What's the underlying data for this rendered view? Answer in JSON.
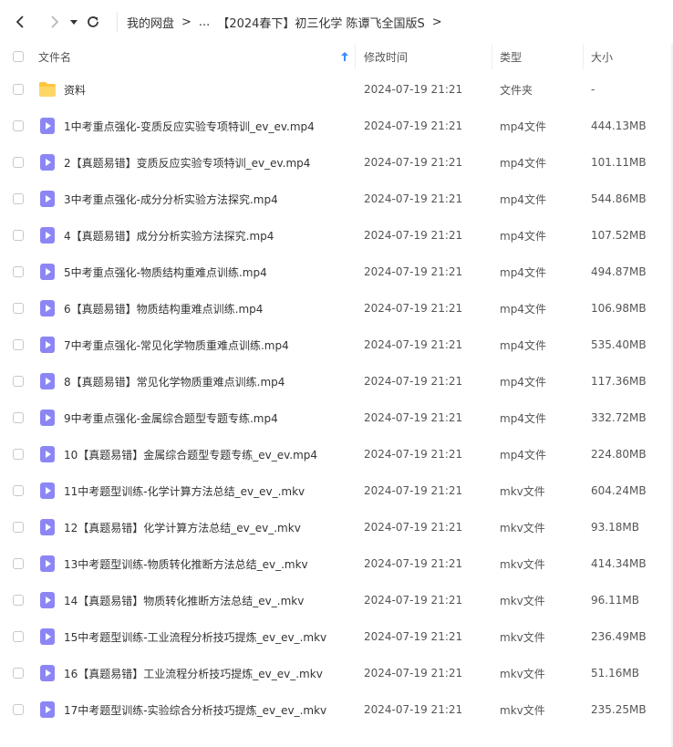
{
  "breadcrumb": {
    "items": [
      "我的网盘",
      "...",
      "【2024春下】初三化学 陈谭飞全国版S"
    ],
    "separator": ">"
  },
  "columns": {
    "name": "文件名",
    "time": "修改时间",
    "type": "类型",
    "size": "大小"
  },
  "icons": {
    "back": "chevron-left-icon",
    "forward": "chevron-right-icon",
    "history": "caret-down-icon",
    "refresh": "refresh-icon",
    "sort": "sort-arrow-up-icon",
    "folder": "folder-icon",
    "video": "video-file-icon"
  },
  "colors": {
    "accent": "#3b8cff",
    "folder": "#ffc53d",
    "video_icon": "#8c86f5"
  },
  "files": [
    {
      "name": "资料",
      "time": "2024-07-19 21:21",
      "type": "文件夹",
      "size": "-",
      "kind": "folder"
    },
    {
      "name": "1中考重点强化-变质反应实验专项特训_ev_ev.mp4",
      "time": "2024-07-19 21:21",
      "type": "mp4文件",
      "size": "444.13MB",
      "kind": "video"
    },
    {
      "name": "2【真题易错】变质反应实验专项特训_ev_ev.mp4",
      "time": "2024-07-19 21:21",
      "type": "mp4文件",
      "size": "101.11MB",
      "kind": "video"
    },
    {
      "name": "3中考重点强化-成分分析实验方法探究.mp4",
      "time": "2024-07-19 21:21",
      "type": "mp4文件",
      "size": "544.86MB",
      "kind": "video"
    },
    {
      "name": "4【真题易错】成分分析实验方法探究.mp4",
      "time": "2024-07-19 21:21",
      "type": "mp4文件",
      "size": "107.52MB",
      "kind": "video"
    },
    {
      "name": "5中考重点强化-物质结构重难点训练.mp4",
      "time": "2024-07-19 21:21",
      "type": "mp4文件",
      "size": "494.87MB",
      "kind": "video"
    },
    {
      "name": "6【真题易错】物质结构重难点训练.mp4",
      "time": "2024-07-19 21:21",
      "type": "mp4文件",
      "size": "106.98MB",
      "kind": "video"
    },
    {
      "name": "7中考重点强化-常见化学物质重难点训练.mp4",
      "time": "2024-07-19 21:21",
      "type": "mp4文件",
      "size": "535.40MB",
      "kind": "video"
    },
    {
      "name": "8【真题易错】常见化学物质重难点训练.mp4",
      "time": "2024-07-19 21:21",
      "type": "mp4文件",
      "size": "117.36MB",
      "kind": "video"
    },
    {
      "name": "9中考重点强化-金属综合题型专题专练.mp4",
      "time": "2024-07-19 21:21",
      "type": "mp4文件",
      "size": "332.72MB",
      "kind": "video"
    },
    {
      "name": "10【真题易错】金属综合题型专题专练_ev_ev.mp4",
      "time": "2024-07-19 21:21",
      "type": "mp4文件",
      "size": "224.80MB",
      "kind": "video"
    },
    {
      "name": "11中考题型训练-化学计算方法总结_ev_ev_.mkv",
      "time": "2024-07-19 21:21",
      "type": "mkv文件",
      "size": "604.24MB",
      "kind": "video"
    },
    {
      "name": "12【真题易错】化学计算方法总结_ev_ev_.mkv",
      "time": "2024-07-19 21:21",
      "type": "mkv文件",
      "size": "93.18MB",
      "kind": "video"
    },
    {
      "name": "13中考题型训练-物质转化推断方法总结_ev_.mkv",
      "time": "2024-07-19 21:21",
      "type": "mkv文件",
      "size": "414.34MB",
      "kind": "video"
    },
    {
      "name": "14【真题易错】物质转化推断方法总结_ev_.mkv",
      "time": "2024-07-19 21:21",
      "type": "mkv文件",
      "size": "96.11MB",
      "kind": "video"
    },
    {
      "name": "15中考题型训练-工业流程分析技巧提炼_ev_ev_.mkv",
      "time": "2024-07-19 21:21",
      "type": "mkv文件",
      "size": "236.49MB",
      "kind": "video"
    },
    {
      "name": "16【真题易错】工业流程分析技巧提炼_ev_ev_.mkv",
      "time": "2024-07-19 21:21",
      "type": "mkv文件",
      "size": "51.16MB",
      "kind": "video"
    },
    {
      "name": "17中考题型训练-实验综合分析技巧提炼_ev_ev_.mkv",
      "time": "2024-07-19 21:21",
      "type": "mkv文件",
      "size": "235.25MB",
      "kind": "video"
    }
  ]
}
